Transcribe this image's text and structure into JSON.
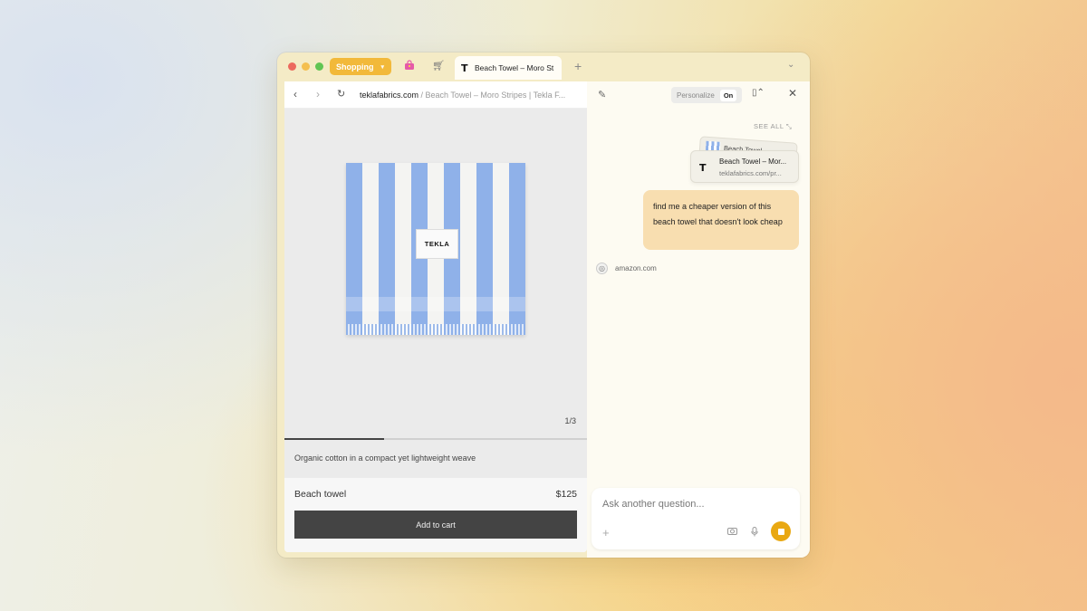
{
  "tabbar": {
    "space_label": "Shopping",
    "active_tab_title": "Beach Towel – Moro St",
    "new_tab_label": "+",
    "icons": [
      "shopping-bag-icon",
      "cart-icon",
      "tekla-logo-icon",
      "chevron-down-icon"
    ]
  },
  "browser": {
    "domain": "teklafabrics.com",
    "path": " / Beach Towel – Moro Stripes | Tekla F...",
    "image_counter": "1/3",
    "image_progress": 0.33,
    "towel_label": "TEKLA",
    "description": "Organic cotton in a compact yet lightweight weave",
    "product_name": "Beach towel",
    "product_price": "$125",
    "add_to_cart": "Add to cart"
  },
  "assistant": {
    "personalize_label": "Personalize",
    "personalize_state": "On",
    "see_all": "SEE ALL",
    "context_card_back_title": "Beach Towel – ...",
    "context_card_title": "Beach Towel – Mor...",
    "context_card_url": "teklafabrics.com/pr...",
    "user_message": "find me a cheaper version of this beach towel that doesn't look cheap",
    "source": "amazon.com",
    "input_placeholder": "Ask another question...",
    "accent_color": "#e9a812"
  }
}
